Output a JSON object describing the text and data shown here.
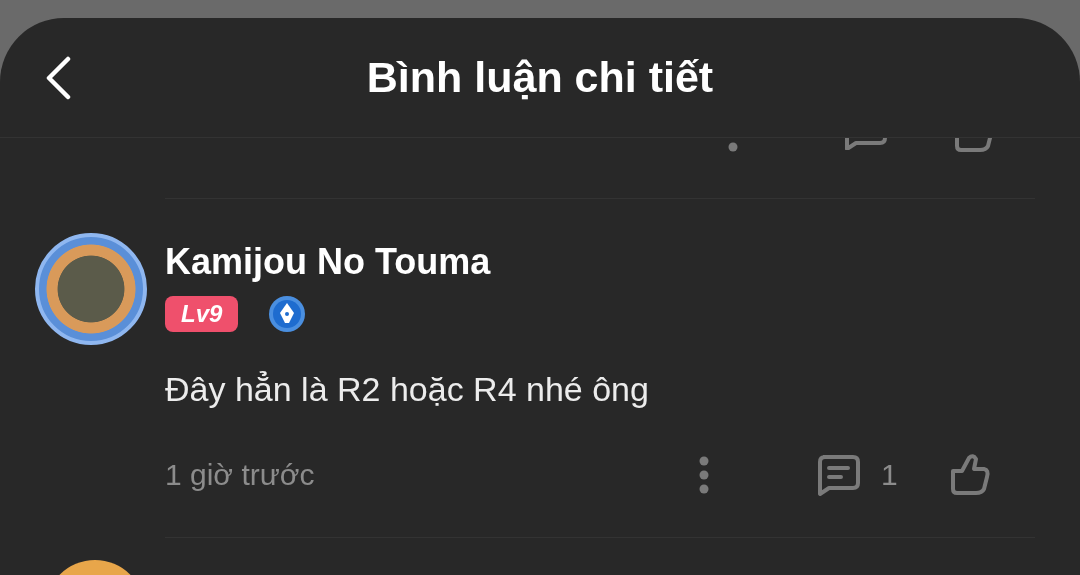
{
  "header": {
    "title": "Bình luận chi tiết"
  },
  "comments": [
    {
      "author": "Kamijou No Touma",
      "level_badge": "Lv9",
      "body": "Đây hẳn là R2 hoặc R4 nhé ông",
      "time": "1 giờ trước",
      "reply_count": "1",
      "liked": false
    }
  ]
}
